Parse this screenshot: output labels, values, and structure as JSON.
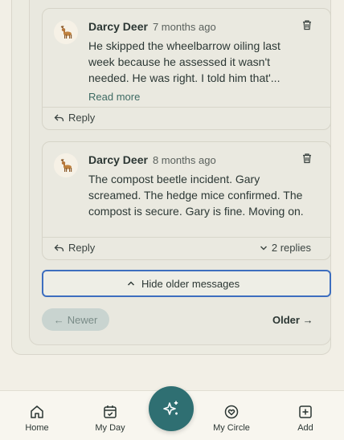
{
  "comments": [
    {
      "author": "Darcy Deer",
      "time": "7 months ago",
      "text": "He skipped the wheelbarrow oiling last week because he assessed it wasn't needed. He was right. I told him that'...",
      "read_more": "Read more",
      "reply": "Reply"
    },
    {
      "author": "Darcy Deer",
      "time": "8 months ago",
      "text": "The compost beetle incident. Gary screamed. The hedge mice confirmed. The compost is secure. Gary is fine. Moving on.",
      "reply": "Reply",
      "replies_toggle": "2 replies"
    }
  ],
  "hide_older": "Hide older messages",
  "pagination": {
    "newer": "Newer",
    "older": "Older"
  },
  "nav": {
    "home": "Home",
    "my_day": "My Day",
    "my_circle": "My Circle",
    "add": "Add"
  },
  "colors": {
    "accent": "#2f6f72",
    "focus": "#3d6ebf"
  }
}
